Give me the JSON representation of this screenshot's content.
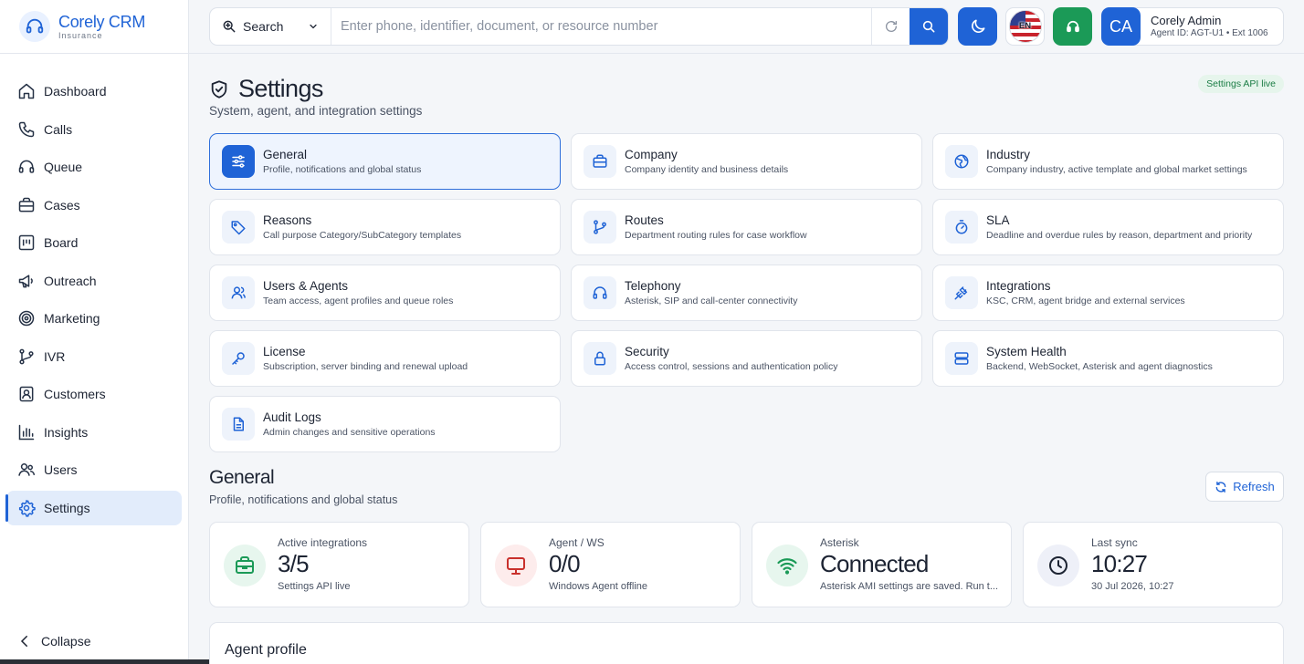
{
  "brand": {
    "name": "Corely CRM",
    "sub": "Insurance"
  },
  "sidebar": {
    "items": [
      {
        "label": "Dashboard",
        "icon": "home-icon"
      },
      {
        "label": "Calls",
        "icon": "phone-icon"
      },
      {
        "label": "Queue",
        "icon": "headset-icon"
      },
      {
        "label": "Cases",
        "icon": "briefcase-icon"
      },
      {
        "label": "Board",
        "icon": "board-icon"
      },
      {
        "label": "Outreach",
        "icon": "megaphone-icon"
      },
      {
        "label": "Marketing",
        "icon": "target-icon"
      },
      {
        "label": "IVR",
        "icon": "branch-icon"
      },
      {
        "label": "Customers",
        "icon": "contact-icon"
      },
      {
        "label": "Insights",
        "icon": "bar-chart-icon"
      },
      {
        "label": "Users",
        "icon": "users-icon"
      },
      {
        "label": "Settings",
        "icon": "gear-icon",
        "active": true
      }
    ],
    "collapse_label": "Collapse"
  },
  "header": {
    "search_type": "Search",
    "search_placeholder": "Enter phone, identifier, document, or resource number",
    "lang": "EN",
    "user_initials": "CA",
    "user_name": "Corely Admin",
    "user_meta": "Agent ID: AGT-U1 • Ext 1006"
  },
  "page": {
    "title": "Settings",
    "subtitle": "System, agent, and integration settings",
    "api_badge": "Settings API live"
  },
  "settings_cards": [
    {
      "title": "General",
      "desc": "Profile, notifications and global status",
      "icon": "sliders-icon",
      "active": true
    },
    {
      "title": "Company",
      "desc": "Company identity and business details",
      "icon": "briefcase-icon"
    },
    {
      "title": "Industry",
      "desc": "Company industry, active template and global market settings",
      "icon": "globe-icon"
    },
    {
      "title": "Reasons",
      "desc": "Call purpose Category/SubCategory templates",
      "icon": "tag-icon"
    },
    {
      "title": "Routes",
      "desc": "Department routing rules for case workflow",
      "icon": "route-icon"
    },
    {
      "title": "SLA",
      "desc": "Deadline and overdue rules by reason, department and priority",
      "icon": "timer-icon"
    },
    {
      "title": "Users & Agents",
      "desc": "Team access, agent profiles and queue roles",
      "icon": "users-icon"
    },
    {
      "title": "Telephony",
      "desc": "Asterisk, SIP and call-center connectivity",
      "icon": "headphones-icon"
    },
    {
      "title": "Integrations",
      "desc": "KSC, CRM, agent bridge and external services",
      "icon": "plug-icon"
    },
    {
      "title": "License",
      "desc": "Subscription, server binding and renewal upload",
      "icon": "key-icon"
    },
    {
      "title": "Security",
      "desc": "Access control, sessions and authentication policy",
      "icon": "lock-icon"
    },
    {
      "title": "System Health",
      "desc": "Backend, WebSocket, Asterisk and agent diagnostics",
      "icon": "server-icon"
    },
    {
      "title": "Audit Logs",
      "desc": "Admin changes and sensitive operations",
      "icon": "document-icon"
    }
  ],
  "general": {
    "title": "General",
    "subtitle": "Profile, notifications and global status",
    "refresh_label": "Refresh"
  },
  "stats": [
    {
      "label": "Active integrations",
      "value": "3/5",
      "note": "Settings API live",
      "icon": "briefcase-icon",
      "color": "#1b9a57",
      "bg": "#e7f6ee"
    },
    {
      "label": "Agent / WS",
      "value": "0/0",
      "note": "Windows Agent offline",
      "icon": "monitor-icon",
      "color": "#c9302c",
      "bg": "#fdecec"
    },
    {
      "label": "Asterisk",
      "value": "Connected",
      "note": "Asterisk AMI settings are saved. Run t...",
      "icon": "wifi-icon",
      "color": "#1b9a57",
      "bg": "#e7f6ee"
    },
    {
      "label": "Last sync",
      "value": "10:27",
      "note": "30 Jul 2026, 10:27",
      "icon": "clock-icon",
      "color": "#1d2433",
      "bg": "#eef0f8"
    }
  ],
  "agent_profile": {
    "title": "Agent profile"
  },
  "colors": {
    "accent": "#1f63d6",
    "success": "#1b9a57",
    "danger": "#c9302c"
  }
}
